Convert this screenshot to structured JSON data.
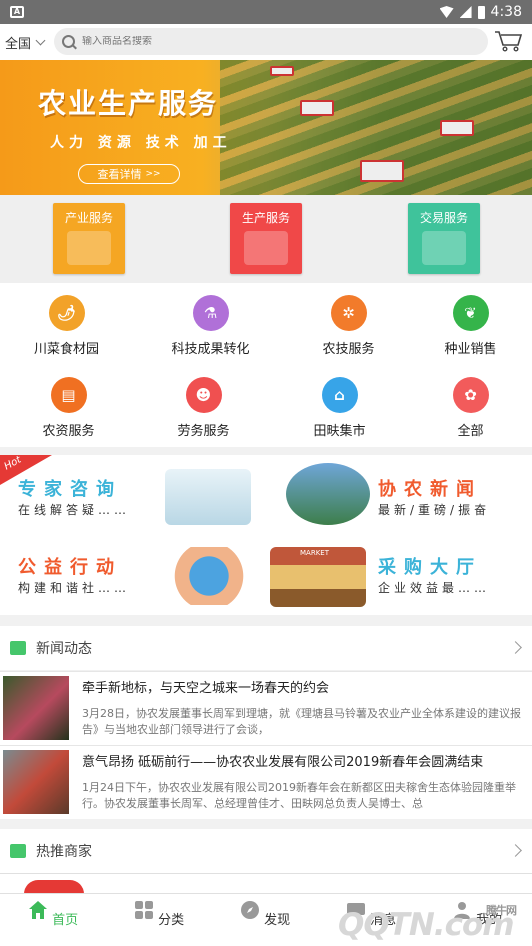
{
  "status": {
    "time": "4:38"
  },
  "header": {
    "region": "全国",
    "search_placeholder": "输入商品名搜索"
  },
  "banner": {
    "title": "农业生产服务",
    "subtitle": "人力 资源 技术 加工",
    "button": "查看详情",
    "active_dot": 2
  },
  "services": [
    {
      "label": "产业服务",
      "color": "#f5a623"
    },
    {
      "label": "生产服务",
      "color": "#f04848"
    },
    {
      "label": "交易服务",
      "color": "#3fc39b"
    }
  ],
  "categories": [
    {
      "label": "川菜食材园",
      "color": "#f2a229",
      "icon": "chili-icon"
    },
    {
      "label": "科技成果转化",
      "color": "#b070d8",
      "icon": "microscope-icon"
    },
    {
      "label": "农技服务",
      "color": "#f27b2b",
      "icon": "wheat-icon"
    },
    {
      "label": "种业销售",
      "color": "#35b44a",
      "icon": "seedling-icon"
    },
    {
      "label": "农资服务",
      "color": "#f07022",
      "icon": "fertilizer-icon"
    },
    {
      "label": "劳务服务",
      "color": "#f05050",
      "icon": "worker-icon"
    },
    {
      "label": "田畉集市",
      "color": "#37a4e8",
      "icon": "market-icon"
    },
    {
      "label": "全部",
      "color": "#f25b5b",
      "icon": "grid-icon"
    }
  ],
  "promo": {
    "hot": "Hot",
    "expert_title": "专家咨询",
    "expert_sub": "在线解答疑……",
    "news_title": "协农新闻",
    "news_sub": "最新/重磅/振奋",
    "charity_title": "公益行动",
    "charity_sub": "构建和谐社……",
    "purchase_title": "采购大厅",
    "purchase_sub": "企业效益最……",
    "market_sign": "MARKET"
  },
  "news_section": {
    "title": "新闻动态"
  },
  "news": [
    {
      "title": "牵手新地标，与天空之城来一场春天的约会",
      "desc": "3月28日，协农发展董事长周军到理塘，就《理塘县马铃薯及农业产业全体系建设的建议报告》与当地农业部门领导进行了会谈，"
    },
    {
      "title": "意气昂扬 砥砺前行——协农农业发展有限公司2019新春年会圆满结束",
      "desc": "1月24日下午，协农农业发展有限公司2019新春年会在新都区田夫稼舍生态体验园隆重举行。协农发展董事长周军、总经理曾佳才、田畉网总负责人吴博士、总"
    }
  ],
  "merchant_section": {
    "title": "热推商家"
  },
  "nav": [
    {
      "label": "首页",
      "active": true
    },
    {
      "label": "分类",
      "active": false
    },
    {
      "label": "发现",
      "active": false
    },
    {
      "label": "消息",
      "active": false
    },
    {
      "label": "我的",
      "active": false
    }
  ],
  "watermark": {
    "text": "QQTN.com",
    "top": "腾牛网"
  },
  "colors": {
    "accent": "#3cba59",
    "status_bar": "#6e6e6e"
  }
}
